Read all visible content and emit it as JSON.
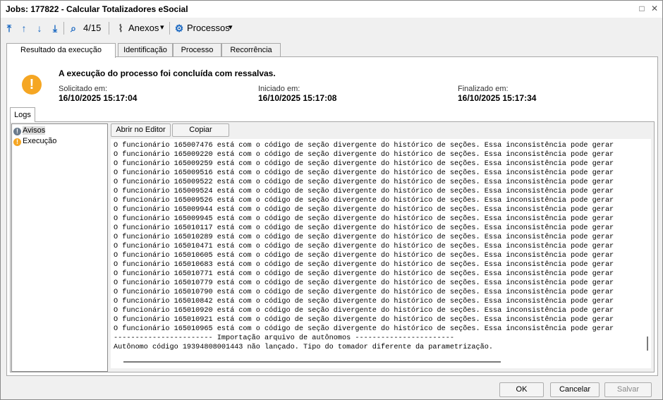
{
  "window": {
    "title": "Jobs: 177822 - Calcular Totalizadores eSocial",
    "restore_glyph": "□",
    "close_glyph": "✕"
  },
  "toolbar": {
    "first_glyph": "⤒",
    "up_glyph": "↑",
    "down_glyph": "↓",
    "last_glyph": "⤓",
    "search_glyph": "⌕",
    "counter": "4/15",
    "anexos_label": "Anexos",
    "processos_label": "Processos",
    "caret": "▾",
    "clip_glyph": "⌇",
    "gear_glyph": "⚙"
  },
  "tabs": [
    "Resultado da execução",
    "Identificação",
    "Processo",
    "Recorrência"
  ],
  "result": {
    "warn_glyph": "!",
    "message": "A execução do processo foi concluída com ressalvas.",
    "solicitado_label": "Solicitado em:",
    "solicitado_value": "16/10/2025 15:17:04",
    "iniciado_label": "Iniciado em:",
    "iniciado_value": "16/10/2025 15:17:08",
    "finalizado_label": "Finalizado em:",
    "finalizado_value": "16/10/2025 15:17:34"
  },
  "logs": {
    "tab_label": "Logs",
    "tree": [
      {
        "label": "Avisos",
        "glyph": "!",
        "color": "#6b7b8c"
      },
      {
        "label": "Execução",
        "glyph": "!",
        "color": "#f5a623"
      }
    ],
    "open_editor_label": "Abrir no Editor",
    "copy_label": "Copiar",
    "lines": [
      "O funcionário 165007476 está com o código de seção divergente do histórico de seções. Essa inconsistência pode gerar",
      "O funcionário 165009220 está com o código de seção divergente do histórico de seções. Essa inconsistência pode gerar",
      "O funcionário 165009259 está com o código de seção divergente do histórico de seções. Essa inconsistência pode gerar",
      "O funcionário 165009516 está com o código de seção divergente do histórico de seções. Essa inconsistência pode gerar",
      "O funcionário 165009522 está com o código de seção divergente do histórico de seções. Essa inconsistência pode gerar",
      "O funcionário 165009524 está com o código de seção divergente do histórico de seções. Essa inconsistência pode gerar",
      "O funcionário 165009526 está com o código de seção divergente do histórico de seções. Essa inconsistência pode gerar",
      "O funcionário 165009944 está com o código de seção divergente do histórico de seções. Essa inconsistência pode gerar",
      "O funcionário 165009945 está com o código de seção divergente do histórico de seções. Essa inconsistência pode gerar",
      "O funcionário 165010117 está com o código de seção divergente do histórico de seções. Essa inconsistência pode gerar",
      "O funcionário 165010289 está com o código de seção divergente do histórico de seções. Essa inconsistência pode gerar",
      "O funcionário 165010471 está com o código de seção divergente do histórico de seções. Essa inconsistência pode gerar",
      "O funcionário 165010605 está com o código de seção divergente do histórico de seções. Essa inconsistência pode gerar",
      "O funcionário 165010683 está com o código de seção divergente do histórico de seções. Essa inconsistência pode gerar",
      "O funcionário 165010771 está com o código de seção divergente do histórico de seções. Essa inconsistência pode gerar",
      "O funcionário 165010779 está com o código de seção divergente do histórico de seções. Essa inconsistência pode gerar",
      "O funcionário 165010790 está com o código de seção divergente do histórico de seções. Essa inconsistência pode gerar",
      "O funcionário 165010842 está com o código de seção divergente do histórico de seções. Essa inconsistência pode gerar",
      "O funcionário 165010920 está com o código de seção divergente do histórico de seções. Essa inconsistência pode gerar",
      "O funcionário 165010921 está com o código de seção divergente do histórico de seções. Essa inconsistência pode gerar",
      "O funcionário 165010965 está com o código de seção divergente do histórico de seções. Essa inconsistência pode gerar",
      "----------------------- Importação arquivo de autônomos -----------------------",
      "Autônomo código 19394808001443 não lançado. Tipo do tomador diferente da parametrização."
    ]
  },
  "footer": {
    "ok_label": "OK",
    "cancel_label": "Cancelar",
    "save_label": "Salvar"
  }
}
